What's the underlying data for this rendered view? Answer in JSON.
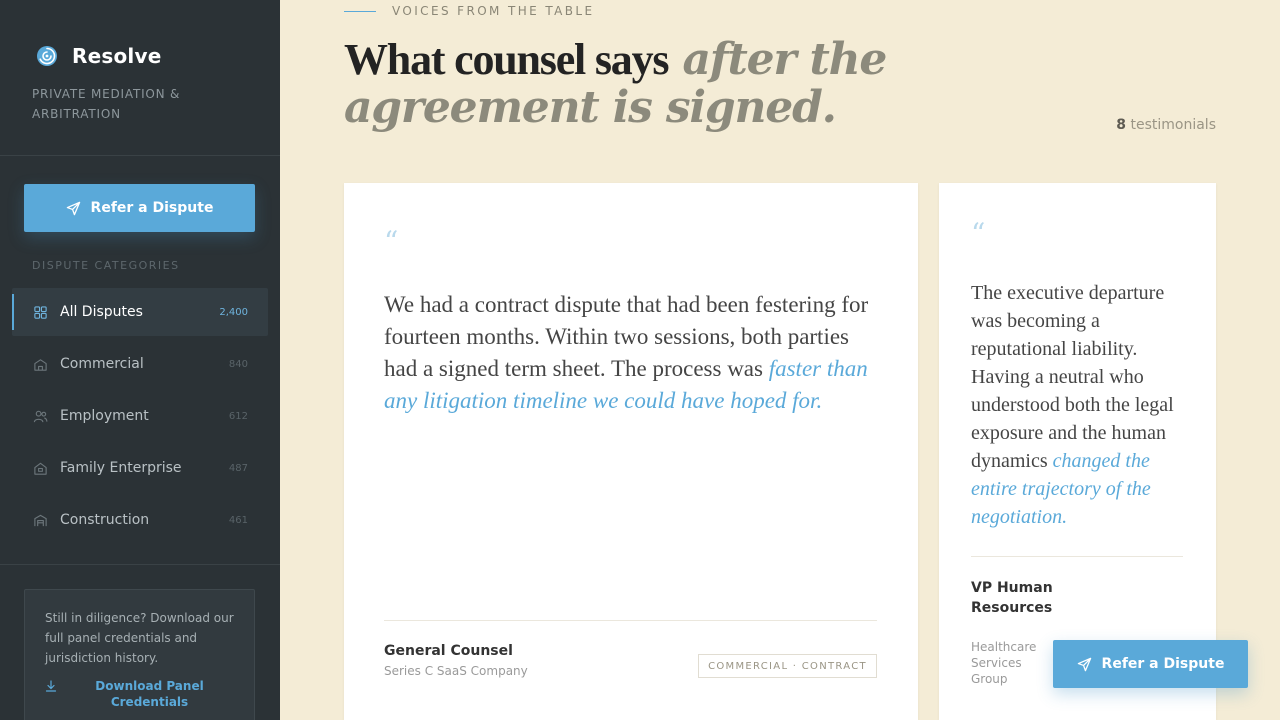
{
  "brand": {
    "name": "Resolve",
    "subtitle": "Private Mediation & Arbitration"
  },
  "sidebar": {
    "refer_label": "Refer a Dispute",
    "categories_heading": "DISPUTE CATEGORIES",
    "items": [
      {
        "label": "All Disputes",
        "count": "2,400",
        "icon": "grid-icon"
      },
      {
        "label": "Commercial",
        "count": "840",
        "icon": "building-icon"
      },
      {
        "label": "Employment",
        "count": "612",
        "icon": "people-icon"
      },
      {
        "label": "Family Enterprise",
        "count": "487",
        "icon": "house-icon"
      },
      {
        "label": "Construction",
        "count": "461",
        "icon": "warehouse-icon"
      }
    ],
    "promo": {
      "text": "Still in diligence? Download our full panel credentials and jurisdiction history.",
      "link": "Download Panel Credentials"
    }
  },
  "main": {
    "eyebrow": "VOICES FROM THE TABLE",
    "headline_plain": "What counsel says",
    "headline_italic": "after the agreement is signed.",
    "count_number": "8",
    "count_label": "testimonials",
    "quote_glyph": "“",
    "testimonials": [
      {
        "text": "We had a contract dispute that had been festering for fourteen months. Within two sessions, both parties had a signed term sheet. The process was ",
        "highlight": "faster than any litigation timeline we could have hoped for.",
        "role": "General Counsel",
        "org": "Series C SaaS Company",
        "tag": "COMMERCIAL · CONTRACT"
      },
      {
        "text": "The executive departure was becoming a reputational liability. Having a neutral who understood both the legal exposure and the human dynamics ",
        "highlight": "changed the entire trajectory of the negotiation.",
        "role": "VP Human Resources",
        "org": "Healthcare Services Group"
      }
    ],
    "floating_refer_label": "Refer a Dispute"
  },
  "colors": {
    "accent": "#5aa9d9",
    "sidebar_bg": "#2b3236",
    "page_bg": "#f4ecd6"
  }
}
